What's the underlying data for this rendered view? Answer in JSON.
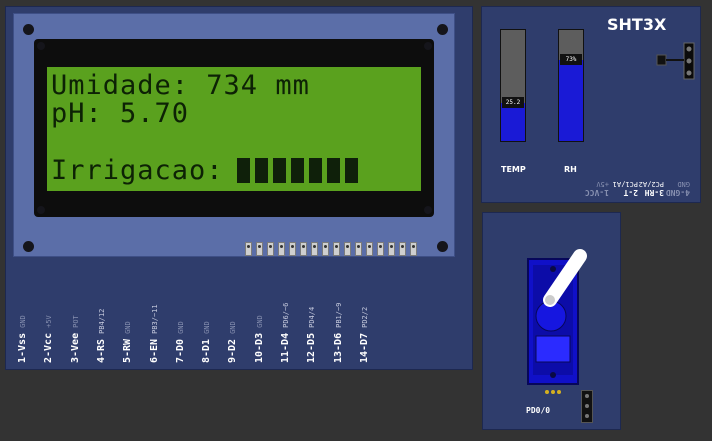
{
  "lcd": {
    "line1": "Umidade: 734 mm",
    "line2": "pH: 5.70",
    "line4_prefix": "Irrigacao:",
    "progress_blocks": 7,
    "pins": [
      {
        "label": "1-Vss",
        "sub": "GND"
      },
      {
        "label": "2-Vcc",
        "sub": "+5V"
      },
      {
        "label": "3-Vee",
        "sub": "POT"
      },
      {
        "label": "4-RS",
        "sub": "PB4/12"
      },
      {
        "label": "5-RW",
        "sub": "GND"
      },
      {
        "label": "6-EN",
        "sub": "PB3/~11"
      },
      {
        "label": "7-D0",
        "sub": "GND"
      },
      {
        "label": "8-D1",
        "sub": "GND"
      },
      {
        "label": "9-D2",
        "sub": "GND"
      },
      {
        "label": "10-D3",
        "sub": "GND"
      },
      {
        "label": "11-D4",
        "sub": "PD6/~6"
      },
      {
        "label": "12-D5",
        "sub": "PD4/4"
      },
      {
        "label": "13-D6",
        "sub": "PB1/~9"
      },
      {
        "label": "14-D7",
        "sub": "PD2/2"
      }
    ]
  },
  "sht3x": {
    "title": "SHT3X",
    "temp": {
      "name": "TEMP",
      "value": "25.2",
      "level": 0.34
    },
    "rh": {
      "name": "RH",
      "value": "73%",
      "level": 0.73
    },
    "pins": [
      {
        "label": "1-VCC",
        "sub": "+5V"
      },
      {
        "label": "2-T",
        "sub": "PC1/A1"
      },
      {
        "label": "3-RH",
        "sub": "PC2/A2"
      },
      {
        "label": "4-GND",
        "sub": "GND"
      }
    ]
  },
  "servo": {
    "label": "PD0/0"
  },
  "colors": {
    "board": "#2f3d6c",
    "lcd_frame": "#5b6ea8",
    "lcd_screen": "#5aa11e",
    "bar_fill": "#1a1ad6",
    "servo_body": "#1010c8"
  }
}
